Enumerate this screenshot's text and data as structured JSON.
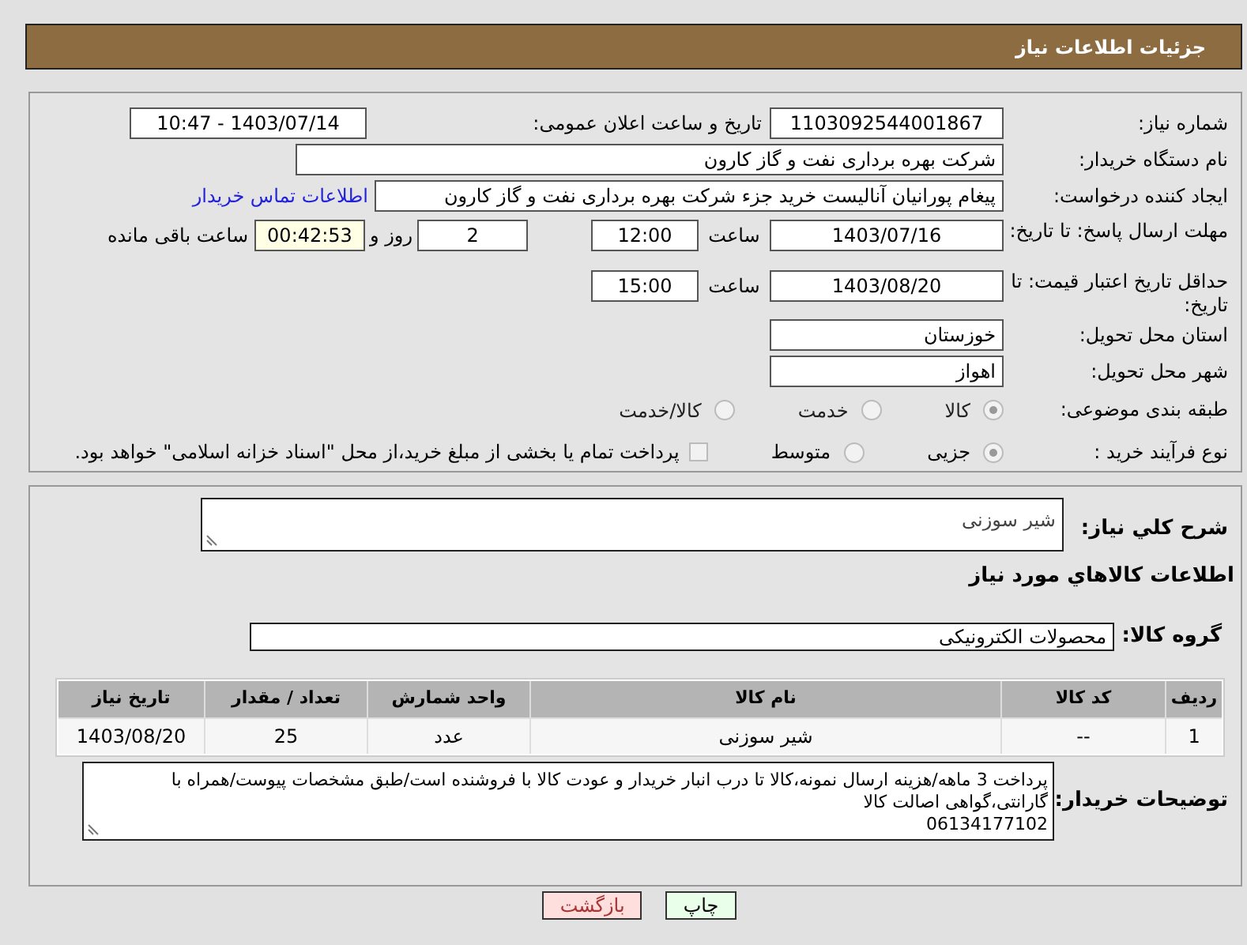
{
  "header": {
    "title": "جزئیات اطلاعات نیاز"
  },
  "need_number": {
    "label": "شماره نیاز:",
    "value": "1103092544001867"
  },
  "announce": {
    "label": "تاریخ و ساعت اعلان عمومی:",
    "value": "1403/07/14 - 10:47"
  },
  "buyer_org": {
    "label": "نام دستگاه خریدار:",
    "value": "شرکت بهره برداری نفت و گاز کارون"
  },
  "requester": {
    "label": "ایجاد کننده درخواست:",
    "value": "پیغام پورانیان آنالیست خرید جزء شرکت بهره برداری نفت و گاز کارون",
    "link": "اطلاعات تماس خریدار"
  },
  "response_deadline": {
    "label": "مهلت ارسال پاسخ: تا تاریخ:",
    "date": "1403/07/16",
    "time_label": "ساعت",
    "time": "12:00",
    "days": "2",
    "days_label": "روز و",
    "remaining": "00:42:53",
    "remaining_label": "ساعت باقی مانده"
  },
  "price_validity": {
    "label": "حداقل تاریخ اعتبار قیمت: تا تاریخ:",
    "date": "1403/08/20",
    "time_label": "ساعت",
    "time": "15:00"
  },
  "province": {
    "label": "استان محل تحویل:",
    "value": "خوزستان"
  },
  "city": {
    "label": "شهر محل تحویل:",
    "value": "اهواز"
  },
  "category": {
    "label": "طبقه بندی موضوعی:",
    "options": [
      {
        "label": "کالا",
        "selected": true
      },
      {
        "label": "خدمت",
        "selected": false
      },
      {
        "label": "کالا/خدمت",
        "selected": false
      }
    ]
  },
  "process": {
    "label": "نوع فرآیند خرید :",
    "options": [
      {
        "label": "جزیی",
        "selected": true
      },
      {
        "label": "متوسط",
        "selected": false
      }
    ],
    "checkbox": {
      "checked": false,
      "label": "پرداخت تمام یا بخشی از مبلغ خرید،از محل \"اسناد خزانه اسلامی\" خواهد بود."
    }
  },
  "summary": {
    "label": "شرح کلي نياز:",
    "value": "شیر سوزنی"
  },
  "goods_heading": "اطلاعات کالاهاي مورد نياز",
  "goods_group": {
    "label": "گروه کالا:",
    "value": "محصولات الکترونیکی"
  },
  "table": {
    "columns": [
      "ردیف",
      "کد کالا",
      "نام کالا",
      "واحد شمارش",
      "تعداد / مقدار",
      "تاریخ نیاز"
    ],
    "rows": [
      [
        "1",
        "--",
        "شیر سوزنی",
        "عدد",
        "25",
        "1403/08/20"
      ]
    ]
  },
  "buyer_notes": {
    "label": "توضیحات خریدار:",
    "lines": [
      "پرداخت 3 ماهه/هزینه ارسال نمونه،کالا تا درب انبار خریدار و عودت کالا با فروشنده است/طبق مشخصات پیوست/همراه با گارانتی،گواهی اصالت کالا",
      "06134177102"
    ]
  },
  "buttons": [
    {
      "kind": "print",
      "label": "چاپ"
    },
    {
      "kind": "back",
      "label": "بازگشت"
    }
  ]
}
